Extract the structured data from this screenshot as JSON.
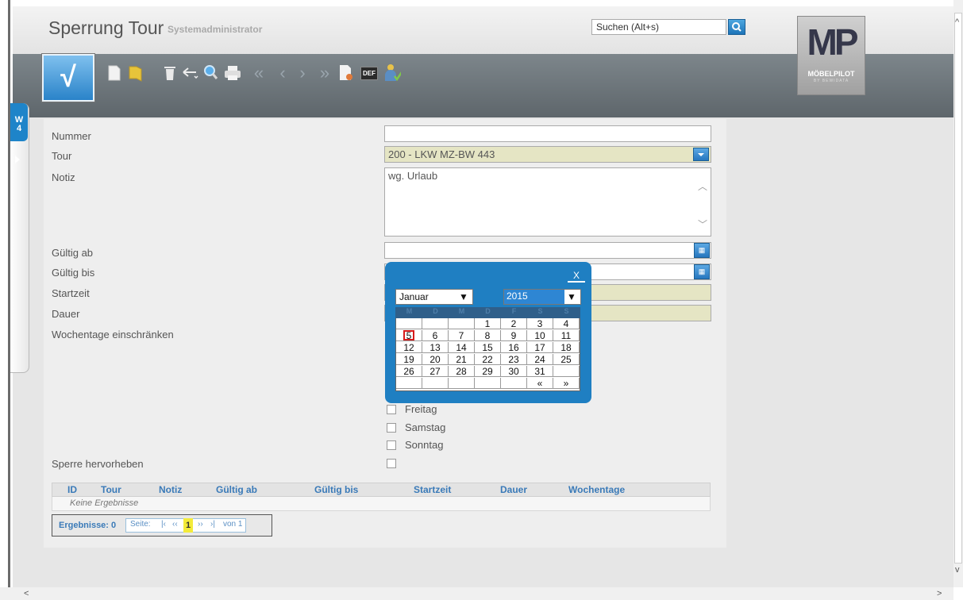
{
  "header": {
    "title": "Sperrung Tour",
    "subtitle": "Systemadministrator",
    "search_placeholder": "Suchen (Alt+s)",
    "logo_text": "MP",
    "logo_name": "MÖBELPILOT",
    "logo_sub": "BY BEWIDATA"
  },
  "toolbar": {
    "save_label": "√",
    "def_label": "DEF"
  },
  "side_tab": {
    "label_line1": "W",
    "label_line2": "4"
  },
  "form": {
    "nummer_label": "Nummer",
    "nummer_value": "",
    "tour_label": "Tour",
    "tour_value": "200 - LKW MZ-BW 443",
    "notiz_label": "Notiz",
    "notiz_value": "wg. Urlaub",
    "gueltig_ab_label": "Gültig ab",
    "gueltig_bis_label": "Gültig bis",
    "startzeit_label": "Startzeit",
    "dauer_label": "Dauer",
    "wochentage_label": "Wochentage einschränken",
    "days": [
      "Freitag",
      "Samstag",
      "Sonntag"
    ],
    "sperre_label": "Sperre hervorheben"
  },
  "grid": {
    "columns": [
      "ID",
      "Tour",
      "Notiz",
      "Gültig ab",
      "Gültig bis",
      "Startzeit",
      "Dauer",
      "Wochentage"
    ],
    "empty_text": "Keine Ergebnisse"
  },
  "pager": {
    "results_label": "Ergebnisse: 0",
    "page_label": "Seite:",
    "first": "|‹",
    "prev": "‹‹",
    "current": "1",
    "next": "››",
    "last": "›|",
    "of_label": "von 1"
  },
  "calendar": {
    "close_label": "X",
    "month": "Januar",
    "year": "2015",
    "day_headers": [
      "M",
      "D",
      "M",
      "D",
      "F",
      "S",
      "S"
    ],
    "weeks": [
      [
        "",
        "",
        "",
        "1",
        "2",
        "3",
        "4"
      ],
      [
        "5",
        "6",
        "7",
        "8",
        "9",
        "10",
        "11"
      ],
      [
        "12",
        "13",
        "14",
        "15",
        "16",
        "17",
        "18"
      ],
      [
        "19",
        "20",
        "21",
        "22",
        "23",
        "24",
        "25"
      ],
      [
        "26",
        "27",
        "28",
        "29",
        "30",
        "31",
        ""
      ],
      [
        "",
        "",
        "",
        "",
        "",
        "«",
        "»"
      ]
    ],
    "today": "5"
  },
  "colors": {
    "accent": "#1f7fc2",
    "header_dark": "#666e73",
    "field_yellow": "#e5e5c4",
    "today_border": "#d61a1a",
    "pager_current": "#f3eb3a"
  }
}
